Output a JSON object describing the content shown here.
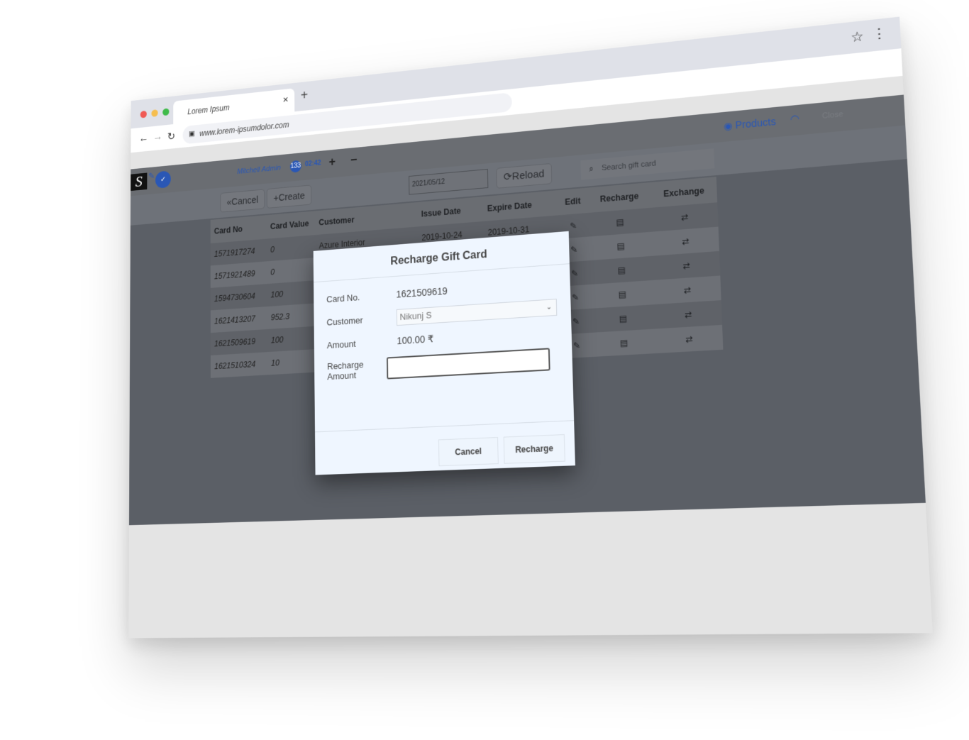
{
  "browser": {
    "tab_title": "Lorem Ipsum",
    "tab_close": "×",
    "new_tab": "+",
    "url": "www.lorem-ipsumdolor.com",
    "back": "←",
    "forward": "→",
    "reload": "↻",
    "lock": "🔒",
    "star": "☆",
    "menu": "⋮"
  },
  "app_header": {
    "logo": "S",
    "user_name": "Mitchell Admin",
    "badge_count": "133",
    "time": "02:42",
    "plus": "+",
    "minus": "−",
    "products": "Products",
    "close": "Close"
  },
  "toolbar": {
    "cancel": "«Cancel",
    "create": "+Create",
    "date": "2021/05/12",
    "reload": "⟳Reload",
    "search_placeholder": "Search gift card"
  },
  "table": {
    "headers": [
      "Card No",
      "Card Value",
      "Customer",
      "Issue Date",
      "Expire Date",
      "Edit",
      "Recharge",
      "Exchange"
    ],
    "rows": [
      {
        "card_no": "1571917274",
        "value": "0",
        "customer": "Azure Interior",
        "issue": "2019-10-24",
        "expire": "2019-10-31"
      },
      {
        "card_no": "1571921489",
        "value": "0",
        "customer": "",
        "issue": "",
        "expire": ""
      },
      {
        "card_no": "1594730604",
        "value": "100",
        "customer": "",
        "issue": "",
        "expire": ""
      },
      {
        "card_no": "1621413207",
        "value": "952.3",
        "customer": "",
        "issue": "",
        "expire": ""
      },
      {
        "card_no": "1621509619",
        "value": "100",
        "customer": "",
        "issue": "",
        "expire": ""
      },
      {
        "card_no": "1621510324",
        "value": "10",
        "customer": "",
        "issue": "",
        "expire": ""
      }
    ],
    "icons": {
      "edit": "✎",
      "recharge": "▤",
      "exchange": "⇄"
    }
  },
  "modal": {
    "title": "Recharge Gift Card",
    "card_no_label": "Card No.",
    "card_no": "1621509619",
    "customer_label": "Customer",
    "customer": "Nikunj S",
    "amount_label": "Amount",
    "amount": "100.00 ₹",
    "recharge_amount_label": "Recharge Amount",
    "recharge_amount_value": "",
    "cancel": "Cancel",
    "recharge": "Recharge"
  }
}
